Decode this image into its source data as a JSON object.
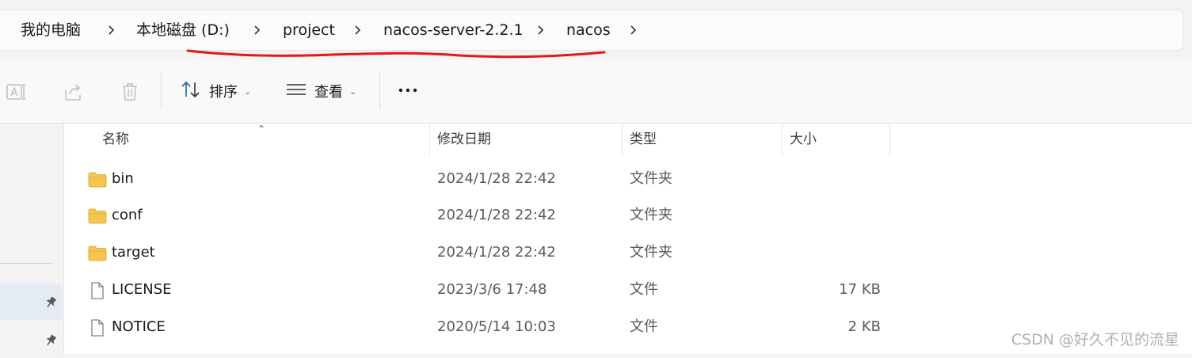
{
  "breadcrumb": {
    "items": [
      "我的电脑",
      "本地磁盘 (D:)",
      "project",
      "nacos-server-2.2.1",
      "nacos"
    ]
  },
  "toolbar": {
    "sort_label": "排序",
    "view_label": "查看",
    "more_label": "···",
    "icons": [
      "rename-icon",
      "share-icon",
      "delete-icon",
      "sort-icon",
      "view-icon",
      "more-icon"
    ]
  },
  "list": {
    "columns": [
      "名称",
      "修改日期",
      "类型",
      "大小"
    ],
    "rows": [
      {
        "name": "bin",
        "date": "2024/1/28 22:42",
        "type": "文件夹",
        "size": "",
        "icon": "folder-icon"
      },
      {
        "name": "conf",
        "date": "2024/1/28 22:42",
        "type": "文件夹",
        "size": "",
        "icon": "folder-icon"
      },
      {
        "name": "target",
        "date": "2024/1/28 22:42",
        "type": "文件夹",
        "size": "",
        "icon": "folder-icon"
      },
      {
        "name": "LICENSE",
        "date": "2023/3/6 17:48",
        "type": "文件",
        "size": "17 KB",
        "icon": "file-icon"
      },
      {
        "name": "NOTICE",
        "date": "2020/5/14 10:03",
        "type": "文件",
        "size": "2 KB",
        "icon": "file-icon"
      }
    ]
  },
  "watermark": "CSDN @好久不见的流星",
  "colors": {
    "annotation_underline": "#e0191b",
    "folder": "#f4c64e",
    "nav_selected": "#e4ebf3"
  }
}
